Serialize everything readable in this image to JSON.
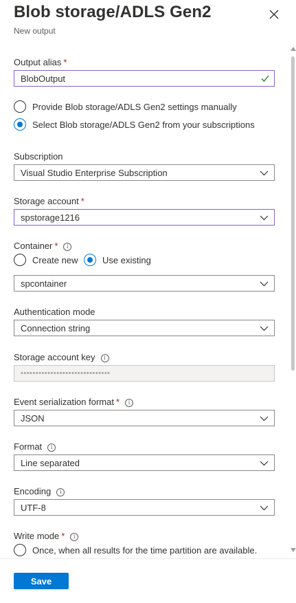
{
  "header": {
    "title": "Blob storage/ADLS Gen2",
    "subtitle": "New output",
    "close_icon": "close-icon"
  },
  "form": {
    "output_alias": {
      "label": "Output alias",
      "required": "*",
      "value": "BlobOutput"
    },
    "source_options": [
      {
        "label": "Provide Blob storage/ADLS Gen2 settings manually",
        "selected": false
      },
      {
        "label": "Select Blob storage/ADLS Gen2 from your subscriptions",
        "selected": true
      }
    ],
    "subscription": {
      "label": "Subscription",
      "value": "Visual Studio Enterprise Subscription"
    },
    "storage_account": {
      "label": "Storage account",
      "required": "*",
      "value": "spstorage1216"
    },
    "container": {
      "label": "Container",
      "required": "*",
      "info": "i",
      "options": [
        {
          "label": "Create new",
          "selected": false
        },
        {
          "label": "Use existing",
          "selected": true
        }
      ],
      "value": "spcontainer"
    },
    "authentication_mode": {
      "label": "Authentication mode",
      "value": "Connection string"
    },
    "storage_account_key": {
      "label": "Storage account key",
      "info": "i",
      "value": "••••••••••••••••••••••••••••••"
    },
    "event_serialization_format": {
      "label": "Event serialization format",
      "required": "*",
      "info": "i",
      "value": "JSON"
    },
    "format": {
      "label": "Format",
      "info": "i",
      "value": "Line separated"
    },
    "encoding": {
      "label": "Encoding",
      "info": "i",
      "value": "UTF-8"
    },
    "write_mode": {
      "label": "Write mode",
      "required": "*",
      "info": "i",
      "options": [
        {
          "label": "Once, when all results for the time partition are available.",
          "selected": false
        }
      ]
    }
  },
  "footer": {
    "save_label": "Save"
  },
  "colors": {
    "accent": "#0078d4",
    "focus_border": "#8661c5",
    "required": "#a4262c",
    "valid_check": "#107c10"
  }
}
